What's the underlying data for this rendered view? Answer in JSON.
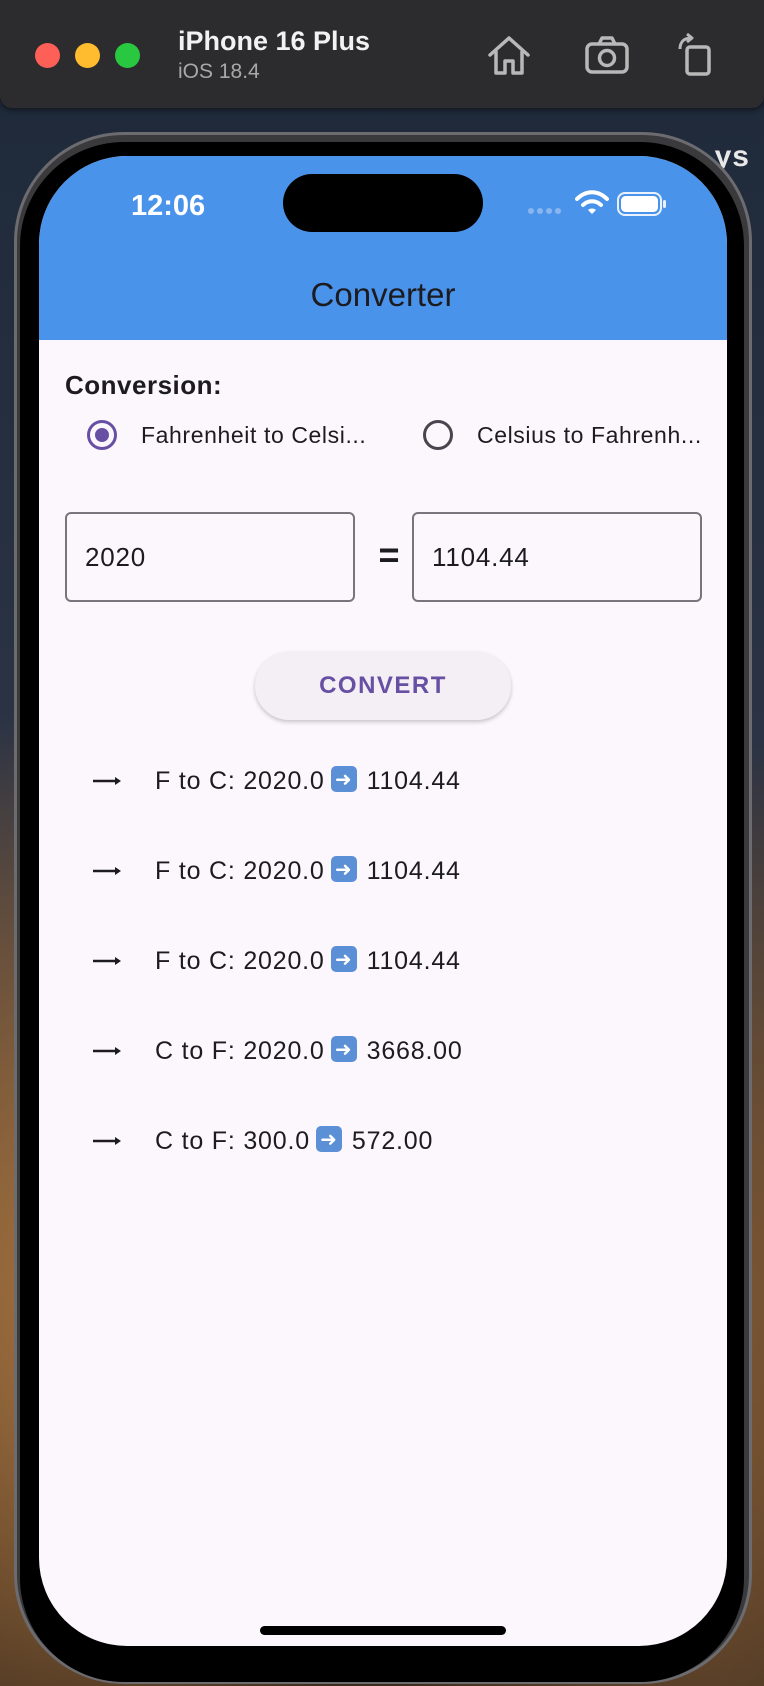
{
  "simulator": {
    "device_name": "iPhone 16 Plus",
    "os_version": "iOS 18.4",
    "background_text": "ys"
  },
  "status_bar": {
    "time": "12:06"
  },
  "app": {
    "title": "Converter",
    "accent_color": "#6750a4",
    "appbar_color": "#4a93eb"
  },
  "conversion": {
    "label": "Conversion:",
    "options": [
      {
        "label": "Fahrenheit to Celsi...",
        "selected": true
      },
      {
        "label": "Celsius to Fahrenh...",
        "selected": false
      }
    ]
  },
  "inputs": {
    "input_value": "2020",
    "equals": "=",
    "result_value": "1104.44"
  },
  "convert_button": {
    "label": "CONVERT"
  },
  "history": [
    {
      "prefix": "F to C: 2020.0",
      "result": "1104.44"
    },
    {
      "prefix": "F to C: 2020.0",
      "result": "1104.44"
    },
    {
      "prefix": "F to C: 2020.0",
      "result": "1104.44"
    },
    {
      "prefix": "C to F: 2020.0",
      "result": "3668.00"
    },
    {
      "prefix": "C to F: 300.0",
      "result": "572.00"
    }
  ]
}
